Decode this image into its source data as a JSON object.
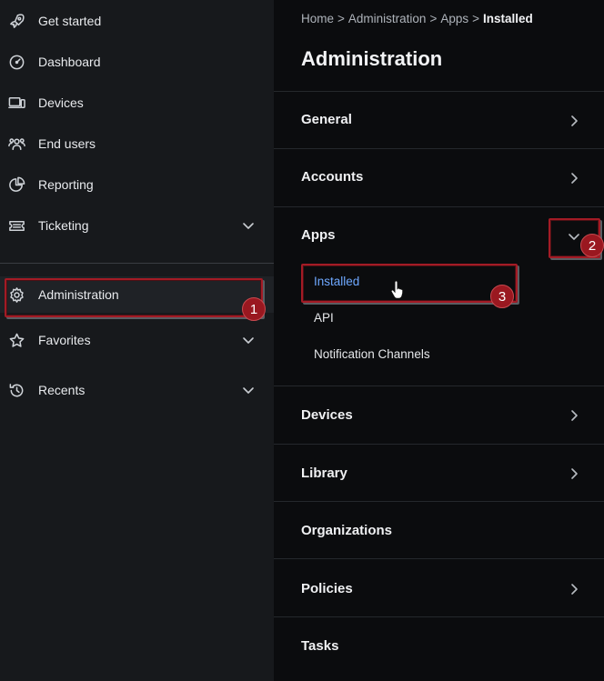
{
  "sidebar": {
    "items": [
      {
        "label": "Get started",
        "icon": "rocket-icon"
      },
      {
        "label": "Dashboard",
        "icon": "gauge-icon"
      },
      {
        "label": "Devices",
        "icon": "devices-icon"
      },
      {
        "label": "End users",
        "icon": "users-icon"
      },
      {
        "label": "Reporting",
        "icon": "pie-chart-icon"
      },
      {
        "label": "Ticketing",
        "icon": "ticket-icon"
      },
      {
        "label": "Administration",
        "icon": "gear-icon"
      },
      {
        "label": "Favorites",
        "icon": "star-icon"
      },
      {
        "label": "Recents",
        "icon": "history-icon"
      }
    ]
  },
  "breadcrumb": {
    "items": [
      "Home",
      "Administration",
      "Apps"
    ],
    "current": "Installed",
    "separator": ">"
  },
  "main": {
    "title": "Administration",
    "sections": [
      {
        "label": "General"
      },
      {
        "label": "Accounts"
      },
      {
        "label": "Apps"
      },
      {
        "label": "Devices"
      },
      {
        "label": "Library"
      },
      {
        "label": "Organizations"
      },
      {
        "label": "Policies"
      },
      {
        "label": "Tasks"
      }
    ],
    "apps_subitems": [
      "Installed",
      "API",
      "Notification Channels"
    ]
  },
  "annotations": {
    "badges": [
      "1",
      "2",
      "3"
    ],
    "highlight_color": "#a31b25"
  },
  "colors": {
    "sidebar_bg": "#17191c",
    "main_bg": "#0b0c0e",
    "selected_link": "#6ea8ff"
  }
}
